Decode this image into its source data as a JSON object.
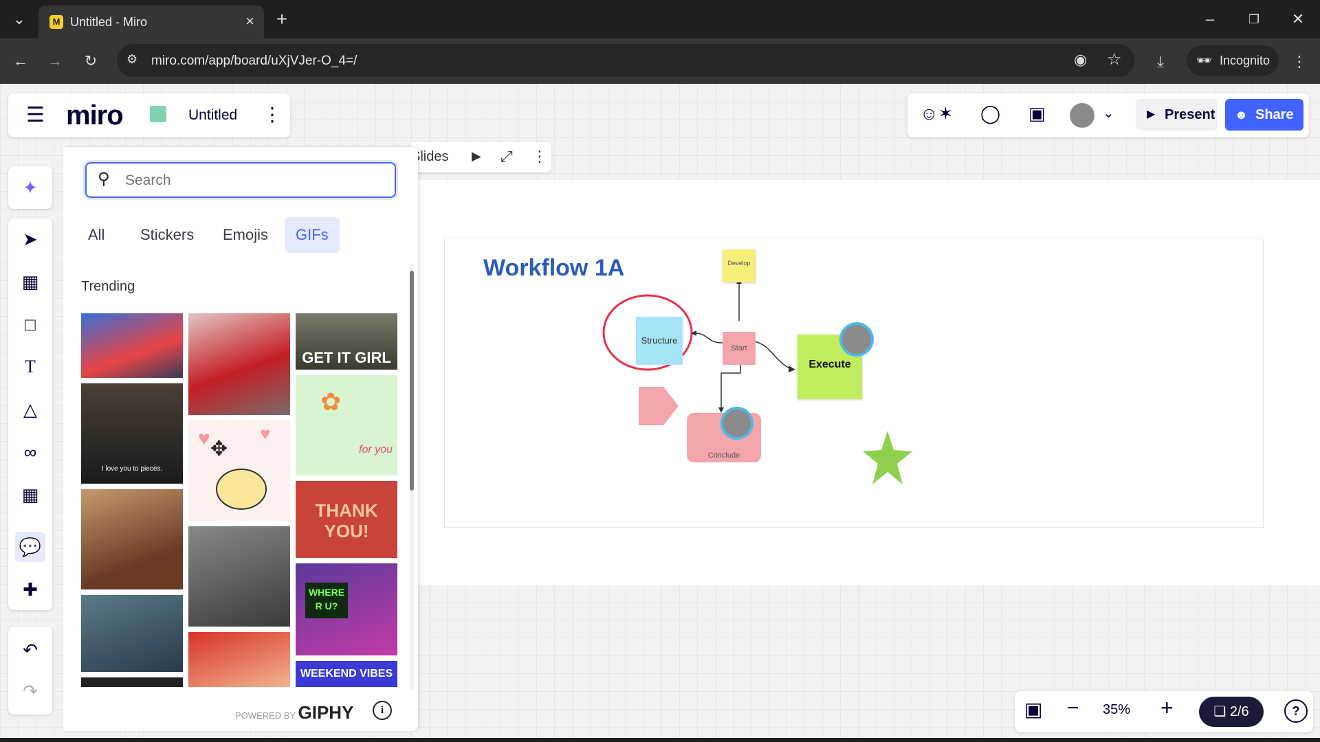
{
  "browser": {
    "tab_title": "Untitled - Miro",
    "url": "miro.com/app/board/uXjVJer-O_4=/",
    "incognito_label": "Incognito"
  },
  "header": {
    "logo": "miro",
    "board_title": "Untitled",
    "present_label": "Present",
    "share_label": "Share"
  },
  "panel": {
    "search_placeholder": "Search",
    "tabs": [
      {
        "label": "All",
        "active": false
      },
      {
        "label": "Stickers",
        "active": false
      },
      {
        "label": "Emojis",
        "active": false
      },
      {
        "label": "GIFs",
        "active": true
      }
    ],
    "section_title": "Trending",
    "gif_texts": {
      "get_it_girl": "GET IT GIRL",
      "love_pieces": "I love you to pieces.",
      "for_you": "for you",
      "thank_you": "THANK YOU!",
      "where_r_u": "WHERE R U?",
      "weekend_vibes": "WEEKEND VIBES"
    },
    "powered_by": "POWERED BY",
    "giphy": "GIPHY"
  },
  "slides_bar": {
    "label": "Slides"
  },
  "board": {
    "title": "Workflow 1A",
    "nodes": {
      "develop": "Develop",
      "structure": "Structure",
      "start": "Start",
      "execute": "Execute",
      "conclude": "Conclude"
    },
    "colors": {
      "title": "#2d5bb9",
      "develop": "#f6ef7a",
      "structure": "#a6e4f8",
      "start": "#f4a5ac",
      "execute": "#c1ec5e",
      "conclude": "#f4a5ac",
      "star": "#8fd14f",
      "circle": "#e8314a"
    }
  },
  "zoom": {
    "level": "35%",
    "pages": "2/6"
  }
}
